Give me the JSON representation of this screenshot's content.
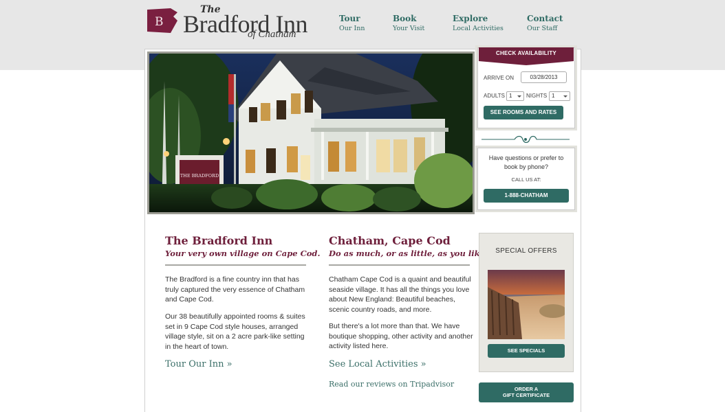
{
  "logo": {
    "initial": "B",
    "the": "The",
    "name": "Bradford Inn",
    "sub": "of Chatham"
  },
  "nav": [
    {
      "title": "Tour",
      "sub": "Our Inn"
    },
    {
      "title": "Book",
      "sub": "Your Visit"
    },
    {
      "title": "Explore",
      "sub": "Local Activities"
    },
    {
      "title": "Contact",
      "sub": "Our Staff"
    }
  ],
  "hero": {
    "sign_text": "THE BRADFORD"
  },
  "availability": {
    "ribbon": "CHECK AVAILABILITY",
    "arrive_label": "ARRIVE ON",
    "arrive_value": "03/28/2013",
    "adults_label": "ADULTS",
    "adults_value": "1",
    "nights_label": "NIGHTS",
    "nights_value": "1",
    "button": "SEE ROOMS AND RATES"
  },
  "phone": {
    "question": "Have questions or prefer to book by phone?",
    "call_label": "CALL US AT:",
    "number": "1-888-CHATHAM"
  },
  "col1": {
    "title": "The Bradford Inn",
    "tagline": "Your very own village on Cape Cod.",
    "p1": "The Bradford is a fine country inn that has truly captured the very essence of Chatham and Cape Cod.",
    "p2": "Our 38 beautifully appointed rooms & suites set in 9 Cape Cod style houses, arranged village style, sit on a 2 acre park-like setting in the heart of town.",
    "link": "Tour Our Inn »"
  },
  "col2": {
    "title": "Chatham, Cape Cod",
    "tagline": "Do as much, or as little, as you like.",
    "p1": "Chatham Cape Cod is a quaint and beautiful seaside village. It has all the things you love about New England: Beautiful beaches, scenic country roads, and more.",
    "p2": "But there's a lot more than that. We have boutique shopping, other activity and another activity listed here.",
    "link": "See Local Activities »",
    "reviews": "Read our reviews on Tripadvisor"
  },
  "specials": {
    "title": "SPECIAL OFFERS",
    "button": "SEE SPECIALS"
  },
  "gift": {
    "line1": "ORDER A",
    "line2": "GIFT CERTIFICATE"
  },
  "colors": {
    "brand_maroon": "#6e1f3b",
    "accent_teal": "#2f6b64",
    "band_gray": "#e7e7e7"
  }
}
